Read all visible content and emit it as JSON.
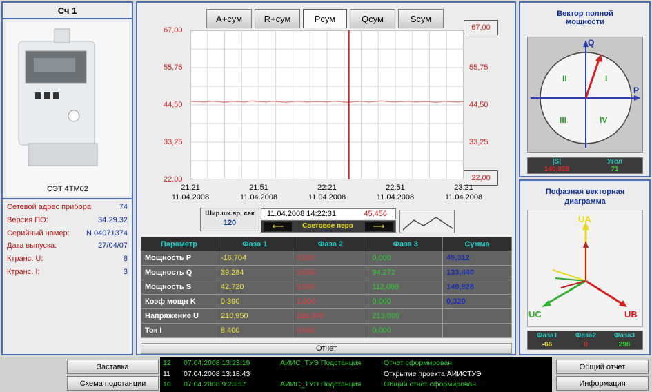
{
  "meter": {
    "title": "Сч 1",
    "model": "СЭТ 4ТМ02",
    "info": [
      {
        "label": "Сетевой адрес прибора:",
        "value": "74"
      },
      {
        "label": "Версия ПО:",
        "value": "34.29.32"
      },
      {
        "label": "Серийный номер:",
        "value": "N 04071374"
      },
      {
        "label": "Дата выпуска:",
        "value": "27/04/07"
      },
      {
        "label": "Ктранс. U:",
        "value": "8"
      },
      {
        "label": "Ктранс. I:",
        "value": "3"
      }
    ]
  },
  "tabs": [
    {
      "label": "A+сум"
    },
    {
      "label": "R+сум"
    },
    {
      "label": "Pсум"
    },
    {
      "label": "Qсум"
    },
    {
      "label": "Sсум"
    }
  ],
  "chart_data": {
    "type": "line",
    "yticks": [
      "67,00",
      "55,75",
      "44,50",
      "33,25",
      "22,00"
    ],
    "ylim": [
      22.0,
      67.0
    ],
    "xticks": [
      {
        "time": "21:21",
        "date": "11.04.2008"
      },
      {
        "time": "21:51",
        "date": "11.04.2008"
      },
      {
        "time": "22:21",
        "date": "11.04.2008"
      },
      {
        "time": "22:51",
        "date": "11.04.2008"
      },
      {
        "time": "23:21",
        "date": "11.04.2008"
      }
    ],
    "right_top_label": "67,00",
    "right_bottom_label": "22,00",
    "values": [
      45.6,
      45.5,
      45.4,
      45.6,
      45.5,
      45.3,
      45.6,
      45.5,
      45.4,
      45.7,
      45.5,
      45.4,
      45.6,
      45.5,
      45.3,
      45.5,
      45.6,
      45.4,
      45.5,
      45.5,
      45.4,
      45.6,
      45.5,
      45.3,
      45.5,
      45.6,
      45.4,
      45.5,
      45.7,
      45.5,
      45.4,
      45.5,
      45.6,
      45.4,
      45.5,
      45.5,
      45.3,
      45.6,
      45.5,
      45.4,
      45.5
    ],
    "cursor_fraction": 0.58,
    "line_color": "#e08a8a",
    "cursor_color": "#c0282f"
  },
  "cursor": {
    "width_label": "Шир.шк.вр, сек",
    "width_value": "120",
    "datetime": "11.04.2008 14:22:31",
    "value": "45,456",
    "pen_label": "Световое перо"
  },
  "table": {
    "headers": [
      "Параметр",
      "Фаза 1",
      "Фаза 2",
      "Фаза 3",
      "Сумма"
    ],
    "rows": [
      {
        "name": "Мощность P",
        "f1": "-16,704",
        "f2": "0,000",
        "f3": "0,000",
        "sum": "45,312"
      },
      {
        "name": "Мощность Q",
        "f1": "39,284",
        "f2": "0,000",
        "f3": "94,272",
        "sum": "133,440"
      },
      {
        "name": "Мощность S",
        "f1": "42,720",
        "f2": "0,000",
        "f3": "112,080",
        "sum": "140,928"
      },
      {
        "name": "Коэф мощн K",
        "f1": "0,390",
        "f2": "1,000",
        "f3": "0,000",
        "sum": "0,320"
      },
      {
        "name": "Напряжение U",
        "f1": "210,950",
        "f2": "218,300",
        "f3": "213,000",
        "sum": ""
      },
      {
        "name": "Ток I",
        "f1": "8,400",
        "f2": "0,000",
        "f3": "0,000",
        "sum": ""
      }
    ],
    "colors": {
      "f1": "#f2e84a",
      "f2": "#e04040",
      "f3": "#30d030",
      "sum": "#1a2fb0"
    }
  },
  "report_button": "Отчет",
  "vector": {
    "title": "Вектор полной мощности",
    "axis_q": "Q",
    "axis_p": "P",
    "quadrants": [
      "I",
      "II",
      "III",
      "IV"
    ],
    "s_label": "|S|",
    "angle_label": "Угол",
    "s_value": "140,928",
    "angle_value": "71"
  },
  "phase": {
    "title": "Пофазная векторная диаграмма",
    "ua": "UA",
    "ub": "UB",
    "uc": "UC",
    "headers": [
      "Фаза1",
      "Фаза2",
      "Фаза3"
    ],
    "values": [
      "-66",
      "0",
      "298"
    ]
  },
  "bottom": {
    "left_buttons": [
      "Заставка",
      "Схема подстанции"
    ],
    "right_buttons": [
      "Общий отчет",
      "Информация"
    ],
    "log": [
      {
        "n": "12",
        "time": "07.04.2008 13:23:19",
        "src": "АИИС_ТУЭ Подстанция",
        "msg": "Отчет сформирован",
        "color": "#2fd02f"
      },
      {
        "n": "11",
        "time": "07.04.2008 13:18:43",
        "src": "",
        "msg": "Открытие проекта АИИСТУЭ",
        "color": "#ffffff"
      },
      {
        "n": "10",
        "time": "07.04.2008 9:23:57",
        "src": "АИИС_ТУЭ Подстанция",
        "msg": "Общий отчет сформирован",
        "color": "#2fd02f"
      }
    ]
  }
}
